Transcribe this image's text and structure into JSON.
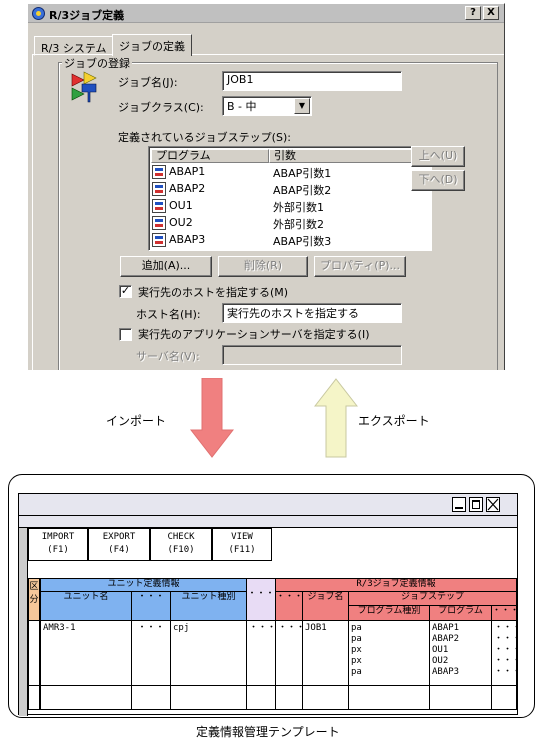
{
  "dialog": {
    "title": "R/3ジョブ定義",
    "help_btn": "?",
    "close_btn": "X",
    "tabs": [
      "R/3 システム",
      "ジョブの定義"
    ],
    "group_title": "ジョブの登録",
    "job_name_label": "ジョブ名(J):",
    "job_name_value": "JOB1",
    "job_class_label": "ジョブクラス(C):",
    "job_class_value": "B - 中",
    "steps_label": "定義されているジョブステップ(S):",
    "list_headers": [
      "プログラム",
      "引数"
    ],
    "steps": [
      {
        "program": "ABAP1",
        "arg": "ABAP引数1"
      },
      {
        "program": "ABAP2",
        "arg": "ABAP引数2"
      },
      {
        "program": "OU1",
        "arg": "外部引数1"
      },
      {
        "program": "OU2",
        "arg": "外部引数2"
      },
      {
        "program": "ABAP3",
        "arg": "ABAP引数3"
      }
    ],
    "up_btn": "上へ(U)",
    "down_btn": "下へ(D)",
    "add_btn": "追加(A)...",
    "delete_btn": "削除(R)",
    "props_btn": "プロパティ(P)...",
    "host_check_label": "実行先のホストを指定する(M)",
    "host_name_label": "ホスト名(H):",
    "host_name_value": "実行先のホストを指定する",
    "app_check_label": "実行先のアプリケーションサーバを指定する(I)",
    "server_name_label": "サーバ名(V):",
    "server_name_value": ""
  },
  "arrows": {
    "import_label": "インポート",
    "export_label": "エクスポート",
    "import_color": "#f08080",
    "export_color": "#f5f5c8"
  },
  "template": {
    "caption": "定義情報管理テンプレート",
    "toolbar": [
      {
        "name": "IMPORT",
        "key": "(F1)"
      },
      {
        "name": "EXPORT",
        "key": "(F4)"
      },
      {
        "name": "CHECK",
        "key": "(F10)"
      },
      {
        "name": "VIEW",
        "key": "(F11)"
      }
    ],
    "kubun": "区分",
    "unit_info": "ユニット定義情報",
    "unit_name": "ユニット名",
    "unit_type": "ユニット種別",
    "ellipsis": "・・・",
    "r3_info": "R/3ジョブ定義情報",
    "job_name": "ジョブ名",
    "job_step": "ジョブステップ",
    "program_type": "プログラム種別",
    "program": "プログラム",
    "row": {
      "unit_name": "AMR3-1",
      "dots": "・・・",
      "unit_type": "cpj",
      "job_name": "JOB1",
      "program_types": "pa\npa\npx\npx\npa",
      "programs": "ABAP1\nABAP2\nOU1\nOU2\nABAP3",
      "trailing": "・・・\n・・・\n・・・\n・・・\n・・・"
    },
    "colors": {
      "blue": "#7fb2f0",
      "pink": "#f08080",
      "lavender": "#e8dcf5",
      "orange": "#f5c79a"
    }
  }
}
